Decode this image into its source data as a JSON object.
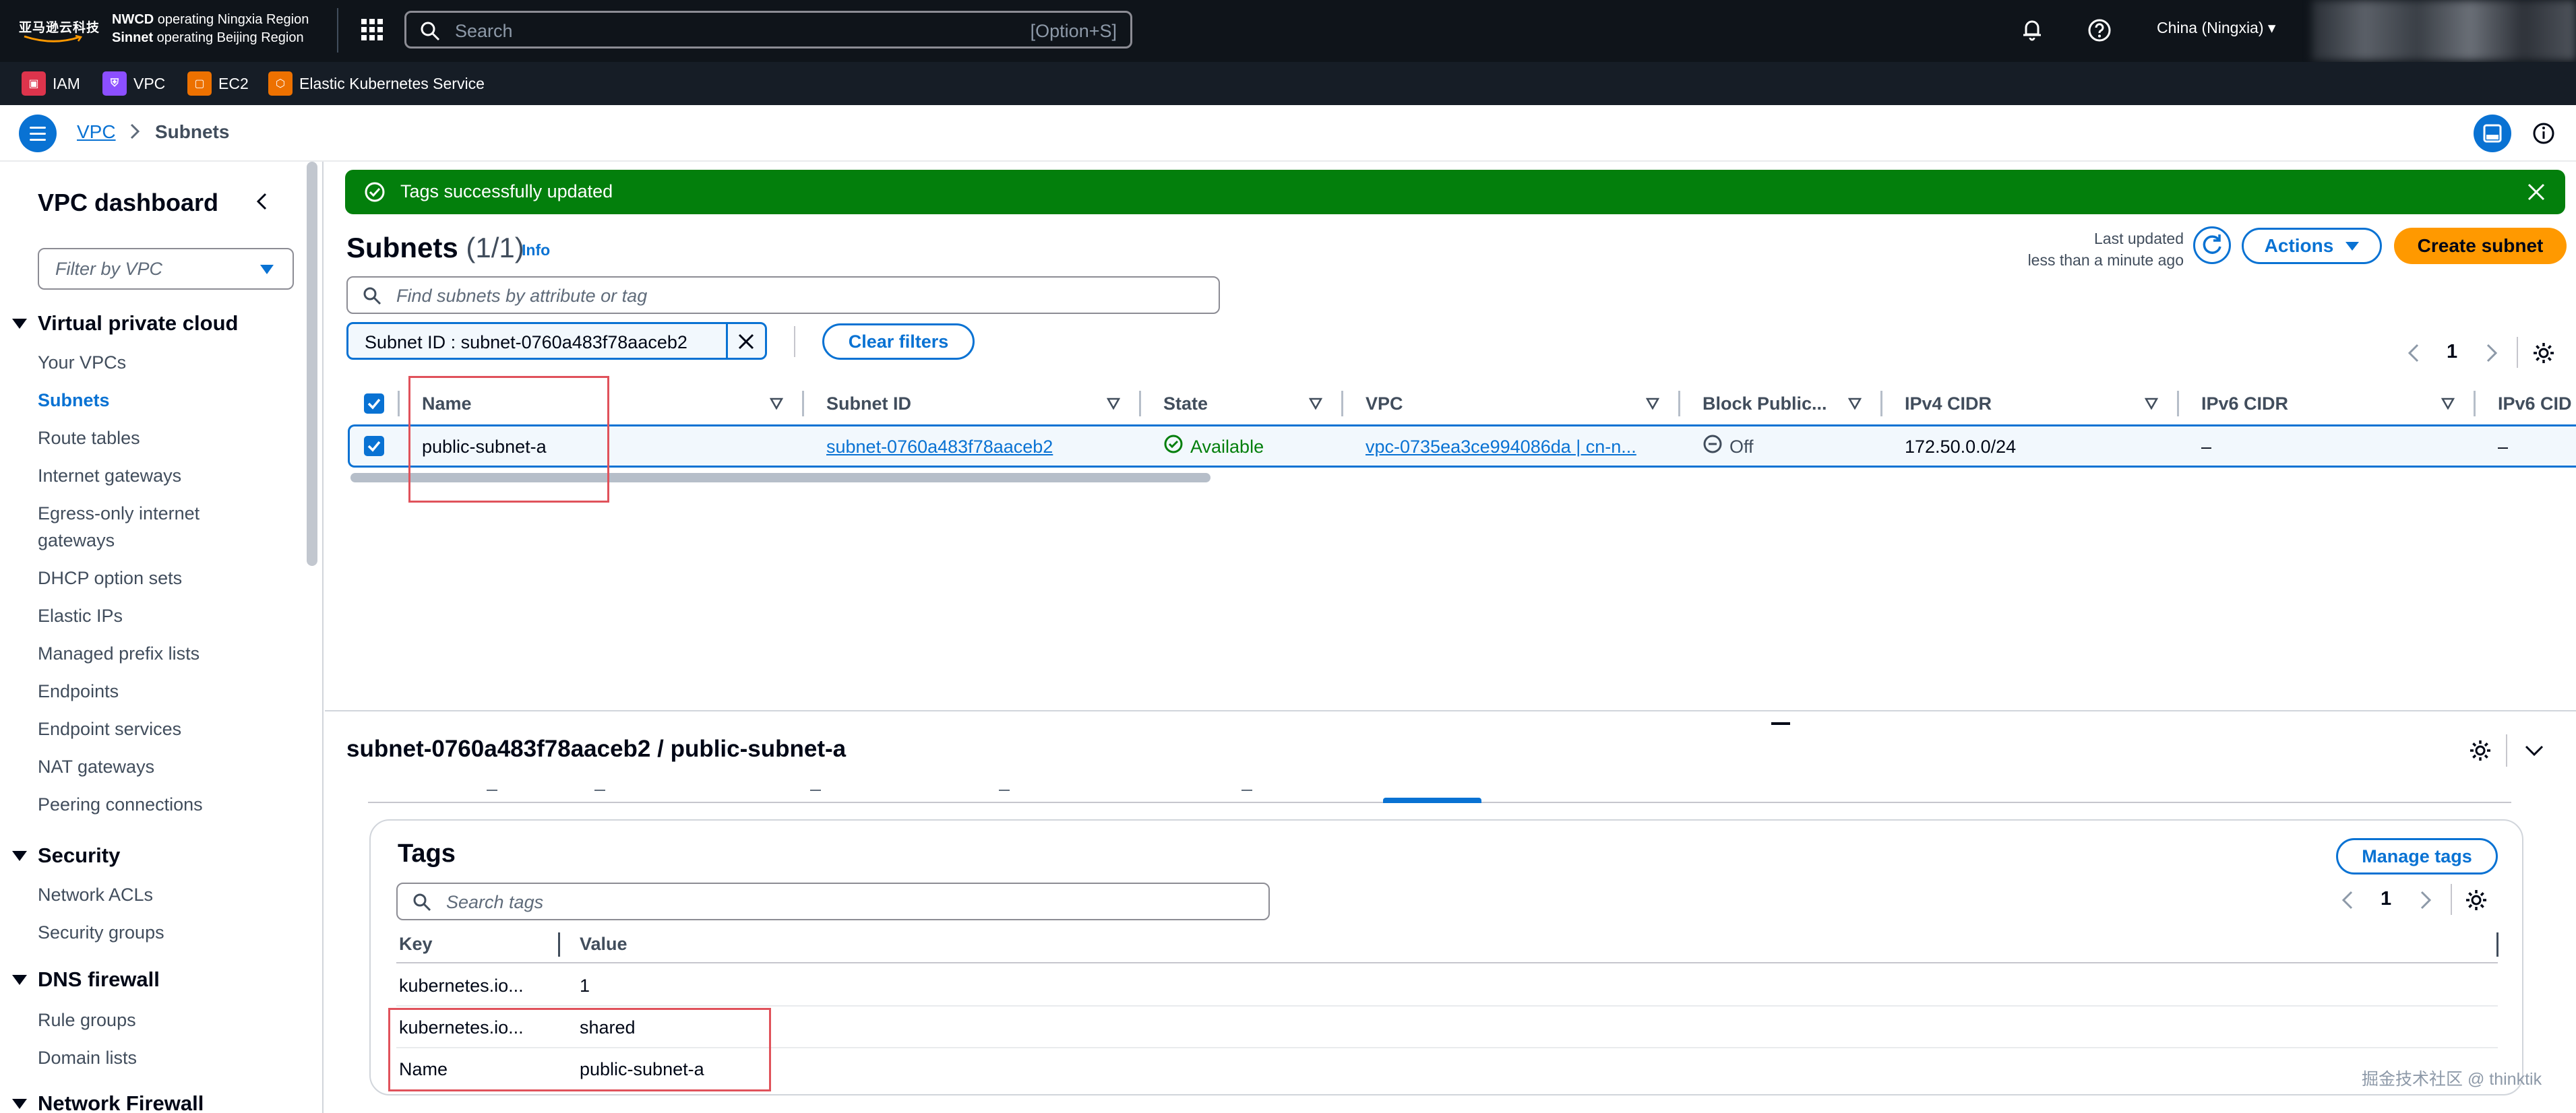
{
  "top_nav": {
    "logo_text": "亚马逊云科技",
    "region_line1_bold": "NWCD",
    "region_line1": " operating Ningxia Region",
    "region_line2_bold": "Sinnet",
    "region_line2": " operating Beijing Region",
    "search_placeholder": "Search",
    "search_shortcut": "[Option+S]",
    "region": "China (Ningxia) ▾"
  },
  "favorites": [
    {
      "label": "IAM",
      "color": "#dd344c",
      "icon": "iam-icon"
    },
    {
      "label": "VPC",
      "color": "#8c4fff",
      "icon": "vpc-icon"
    },
    {
      "label": "EC2",
      "color": "#ed7100",
      "icon": "ec2-icon"
    },
    {
      "label": "Elastic Kubernetes Service",
      "color": "#ed7100",
      "icon": "eks-icon"
    }
  ],
  "breadcrumb": {
    "root": "VPC",
    "current": "Subnets"
  },
  "sidebar": {
    "title": "VPC dashboard",
    "filter_placeholder": "Filter by VPC",
    "sections": {
      "vpc": "Virtual private cloud",
      "security": "Security",
      "dns": "DNS firewall",
      "netfw": "Network Firewall"
    },
    "items": {
      "your_vpcs": "Your VPCs",
      "subnets": "Subnets",
      "route_tables": "Route tables",
      "igw": "Internet gateways",
      "egress1": "Egress-only internet",
      "egress2": "gateways",
      "dhcp": "DHCP option sets",
      "eip": "Elastic IPs",
      "prefix": "Managed prefix lists",
      "endpoints": "Endpoints",
      "endpoint_services": "Endpoint services",
      "nat": "NAT gateways",
      "peering": "Peering connections",
      "nacl": "Network ACLs",
      "sg": "Security groups",
      "rule_groups": "Rule groups",
      "domain_lists": "Domain lists"
    }
  },
  "flash": {
    "message": "Tags successfully updated",
    "status_color": "#037f0c"
  },
  "subnets": {
    "title": "Subnets",
    "count": "(1/1)",
    "info": "Info",
    "last_updated_1": "Last updated",
    "last_updated_2": "less than a minute ago",
    "actions": "Actions",
    "create": "Create subnet",
    "filter_placeholder": "Find subnets by attribute or tag",
    "token": "Subnet ID : subnet-0760a483f78aaceb2",
    "clear_filters": "Clear filters",
    "page": "1",
    "columns": [
      "Name",
      "Subnet ID",
      "State",
      "VPC",
      "Block Public...",
      "IPv4 CIDR",
      "IPv6 CIDR",
      "IPv6 CID"
    ],
    "row": {
      "name": "public-subnet-a",
      "subnet_id": "subnet-0760a483f78aaceb2",
      "state": "Available",
      "vpc": "vpc-0735ea3ce994086da | cn-n...",
      "block_public": "Off",
      "ipv4": "172.50.0.0/24",
      "ipv6": "–",
      "ipv6b": "–"
    }
  },
  "details": {
    "title": "subnet-0760a483f78aaceb2 / public-subnet-a",
    "tags_title": "Tags",
    "manage_tags": "Manage tags",
    "search_placeholder": "Search tags",
    "page": "1",
    "col_key": "Key",
    "col_value": "Value",
    "rows": [
      {
        "key": "kubernetes.io...",
        "value": "1"
      },
      {
        "key": "kubernetes.io...",
        "value": "shared"
      },
      {
        "key": "Name",
        "value": "public-subnet-a"
      }
    ]
  },
  "watermark": "掘金技术社区 @ thinktik"
}
